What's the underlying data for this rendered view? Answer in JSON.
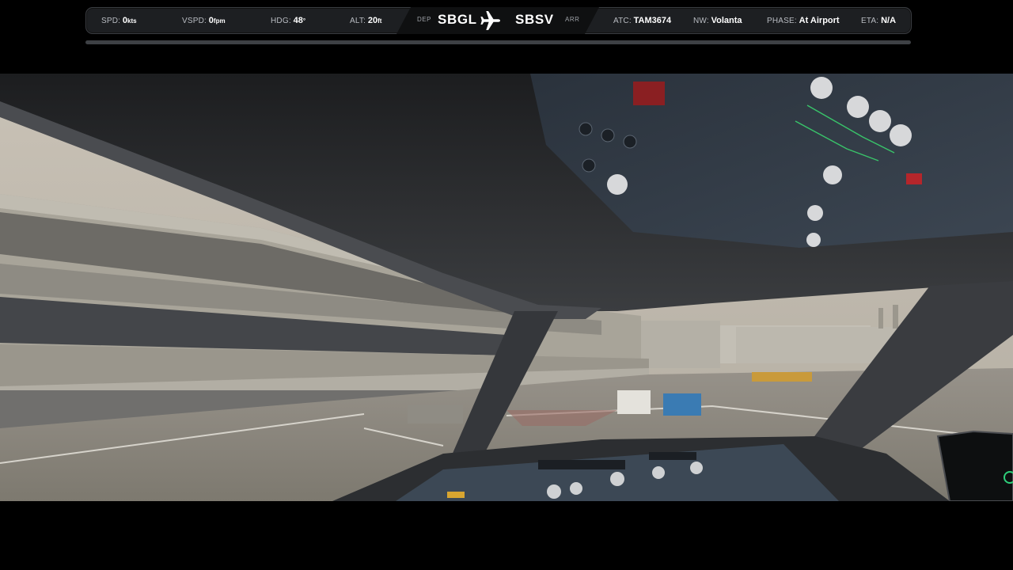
{
  "hud": {
    "spd": {
      "label": "SPD:",
      "value": "0",
      "unit": "kts"
    },
    "vspd": {
      "label": "VSPD:",
      "value": "0",
      "unit": "fpm"
    },
    "hdg": {
      "label": "HDG:",
      "value": "48",
      "unit": "°"
    },
    "alt": {
      "label": "ALT:",
      "value": "20",
      "unit": "ft"
    },
    "route": {
      "dep_label": "DEP",
      "dep_code": "SBGL",
      "arr_code": "SBSV",
      "arr_label": "ARR",
      "icon": "airplane-icon"
    },
    "atc": {
      "label": "ATC:",
      "value": "TAM3674"
    },
    "nw": {
      "label": "NW:",
      "value": "Volanta"
    },
    "phase": {
      "label": "PHASE:",
      "value": "At Airport"
    },
    "eta": {
      "label": "ETA:",
      "value": "N/A"
    },
    "progress_fraction": 0.0
  },
  "scene": {
    "description_icon": "cockpit-view",
    "colors": {
      "sky": "#b9b3a8",
      "tarmac": "#8c877c",
      "terminal": "#a7a398",
      "cockpit": "#2d2f32",
      "panel": "#303842"
    }
  }
}
